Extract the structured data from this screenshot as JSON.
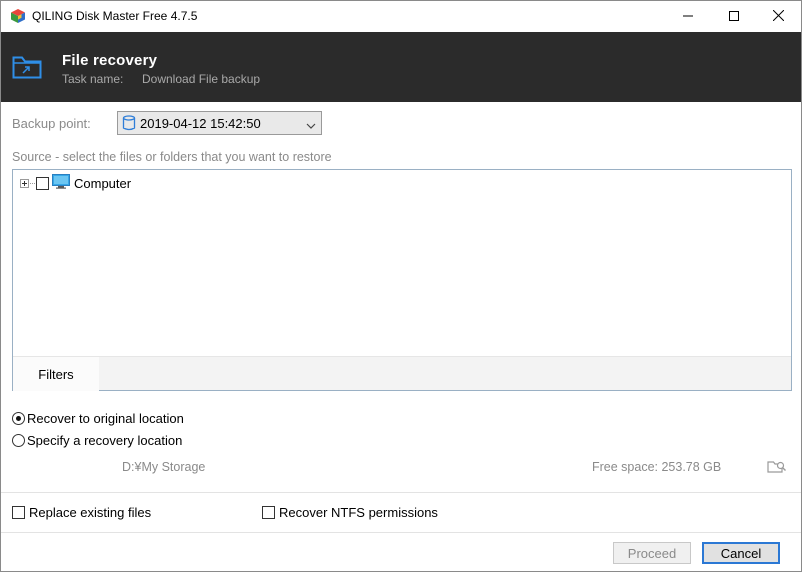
{
  "window": {
    "title": "QILING Disk Master Free 4.7.5",
    "minimize_icon": "minimize-icon",
    "maximize_icon": "maximize-icon",
    "close_icon": "close-icon"
  },
  "header": {
    "title": "File recovery",
    "task_label": "Task name:",
    "task_value": "Download File backup",
    "icon": "folder-recovery-icon",
    "background": "#2b2b2b"
  },
  "backup_point": {
    "label": "Backup point:",
    "selected": "2019-04-12 15:42:50"
  },
  "source": {
    "label": "Source - select the files or folders that you want to restore",
    "tree": [
      {
        "label": "Computer",
        "checked": false,
        "expanded": false
      }
    ],
    "filters_label": "Filters"
  },
  "restore_location": {
    "options": [
      {
        "label": "Recover to original location",
        "selected": true
      },
      {
        "label": "Specify a recovery location",
        "selected": false
      }
    ],
    "path": "D:¥My Storage",
    "free_space": "Free space: 253.78 GB"
  },
  "options": {
    "replace_existing": "Replace existing files",
    "recover_ntfs": "Recover NTFS permissions"
  },
  "buttons": {
    "proceed": "Proceed",
    "cancel": "Cancel"
  },
  "colors": {
    "accent": "#2b78d4",
    "header_bg": "#2b2b2b",
    "muted_text": "#8a8a8a"
  }
}
